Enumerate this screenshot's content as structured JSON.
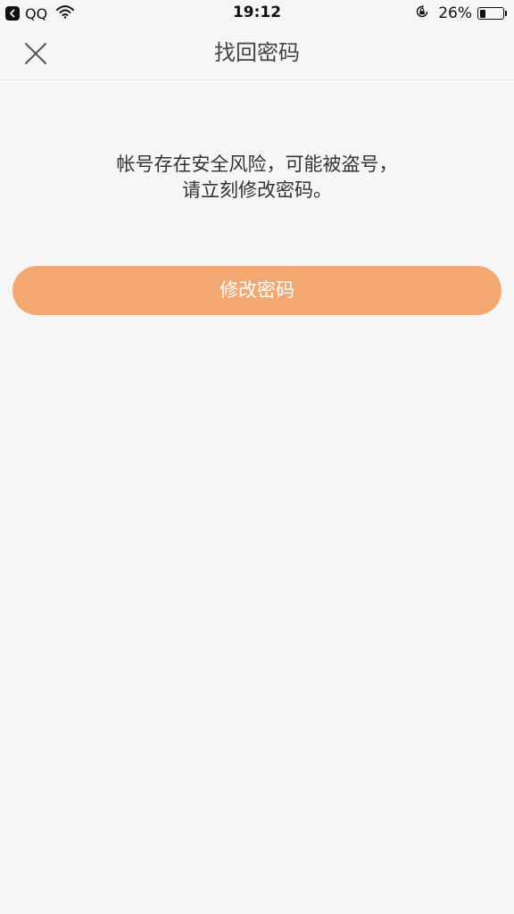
{
  "status_bar": {
    "back_app": "QQ",
    "time": "19:12",
    "battery_percent": "26%",
    "battery_level": 0.26,
    "icons": [
      "back-arrow-icon",
      "wifi-icon",
      "orientation-lock-icon",
      "battery-icon"
    ]
  },
  "nav": {
    "title": "找回密码",
    "close_icon": "close-icon"
  },
  "message": {
    "line1": "帐号存在安全风险，可能被盗号，",
    "line2": "请立刻修改密码。"
  },
  "actions": {
    "change_password_label": "修改密码"
  },
  "colors": {
    "background": "#f6f6f6",
    "accent": "#f3a872",
    "text": "#333333"
  }
}
